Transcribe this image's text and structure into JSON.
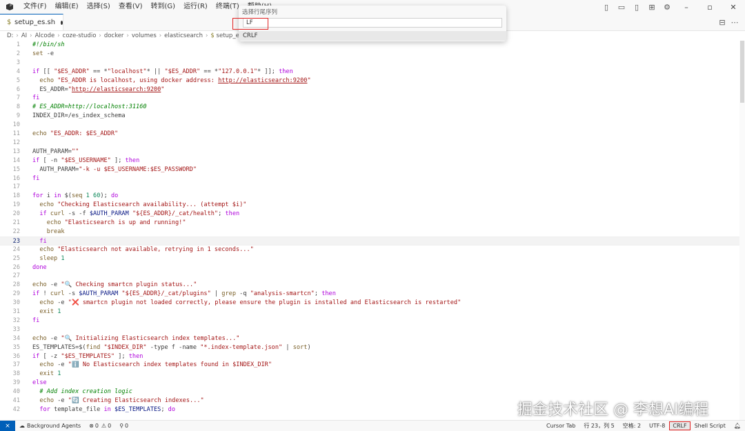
{
  "menu": [
    "文件(F)",
    "编辑(E)",
    "选择(S)",
    "查看(V)",
    "转到(G)",
    "运行(R)",
    "终端(T)",
    "帮助(H)"
  ],
  "tab": {
    "file_icon": "$",
    "label": "setup_es.sh"
  },
  "breadcrumb": [
    "D:",
    "AI",
    "Alcode",
    "coze-studio",
    "docker",
    "volumes",
    "elasticsearch",
    "setup_es.sh"
  ],
  "eol_picker": {
    "title": "选择行尾序列",
    "input_value": "LF",
    "option": "CRLF"
  },
  "code_lines": [
    {
      "n": "1",
      "t": "#!/bin/sh"
    },
    {
      "n": "2",
      "t": "set -e"
    },
    {
      "n": "3",
      "t": ""
    },
    {
      "n": "4",
      "t": "if [[ \"$ES_ADDR\" == *\"localhost\"* || \"$ES_ADDR\" == *\"127.0.0.1\"* ]]; then"
    },
    {
      "n": "5",
      "t": "  echo \"ES_ADDR is localhost, using docker address: http://elasticsearch:9200\""
    },
    {
      "n": "6",
      "t": "  ES_ADDR=\"http://elasticsearch:9200\""
    },
    {
      "n": "7",
      "t": "fi"
    },
    {
      "n": "8",
      "t": "# ES_ADDR=http://localhost:31160"
    },
    {
      "n": "9",
      "t": "INDEX_DIR=/es_index_schema"
    },
    {
      "n": "10",
      "t": ""
    },
    {
      "n": "11",
      "t": "echo \"ES_ADDR: $ES_ADDR\""
    },
    {
      "n": "12",
      "t": ""
    },
    {
      "n": "13",
      "t": "AUTH_PARAM=\"\""
    },
    {
      "n": "14",
      "t": "if [ -n \"$ES_USERNAME\" ]; then"
    },
    {
      "n": "15",
      "t": "  AUTH_PARAM=\"-k -u $ES_USERNAME:$ES_PASSWORD\""
    },
    {
      "n": "16",
      "t": "fi"
    },
    {
      "n": "17",
      "t": ""
    },
    {
      "n": "18",
      "t": "for i in $(seq 1 60); do"
    },
    {
      "n": "19",
      "t": "  echo \"Checking Elasticsearch availability... (attempt $i)\""
    },
    {
      "n": "20",
      "t": "  if curl -s -f $AUTH_PARAM \"${ES_ADDR}/_cat/health\"; then"
    },
    {
      "n": "21",
      "t": "    echo \"Elasticsearch is up and running!\""
    },
    {
      "n": "22",
      "t": "    break"
    },
    {
      "n": "23",
      "t": "  fi"
    },
    {
      "n": "24",
      "t": "  echo \"Elasticsearch not available, retrying in 1 seconds...\""
    },
    {
      "n": "25",
      "t": "  sleep 1"
    },
    {
      "n": "26",
      "t": "done"
    },
    {
      "n": "27",
      "t": ""
    },
    {
      "n": "28",
      "t": "echo -e \"🔍 Checking smartcn plugin status...\""
    },
    {
      "n": "29",
      "t": "if ! curl -s $AUTH_PARAM \"${ES_ADDR}/_cat/plugins\" | grep -q \"analysis-smartcn\"; then"
    },
    {
      "n": "30",
      "t": "  echo -e \"❌ smartcn plugin not loaded correctly, please ensure the plugin is installed and Elasticsearch is restarted\""
    },
    {
      "n": "31",
      "t": "  exit 1"
    },
    {
      "n": "32",
      "t": "fi"
    },
    {
      "n": "33",
      "t": ""
    },
    {
      "n": "34",
      "t": "echo -e \"🔍 Initializing Elasticsearch index templates...\""
    },
    {
      "n": "35",
      "t": "ES_TEMPLATES=$(find \"$INDEX_DIR\" -type f -name \"*.index-template.json\" | sort)"
    },
    {
      "n": "36",
      "t": "if [ -z \"$ES_TEMPLATES\" ]; then"
    },
    {
      "n": "37",
      "t": "  echo -e \"ℹ️ No Elasticsearch index templates found in $INDEX_DIR\""
    },
    {
      "n": "38",
      "t": "  exit 1"
    },
    {
      "n": "39",
      "t": "else"
    },
    {
      "n": "40",
      "t": "  # Add index creation logic"
    },
    {
      "n": "41",
      "t": "  echo -e \"🔄 Creating Elasticsearch indexes...\""
    },
    {
      "n": "42",
      "t": "  for template_file in $ES_TEMPLATES; do"
    }
  ],
  "current_line": "23",
  "status": {
    "background_agents": "Background Agents",
    "errors": "0",
    "warnings": "0",
    "ports": "0",
    "cursor_tab": "Cursor Tab",
    "position": "行 23，列 5",
    "spaces": "空格: 2",
    "encoding": "UTF-8",
    "eol": "CRLF",
    "language": "Shell Script"
  },
  "watermark": "掘金技术社区 @ 李想AI编程"
}
